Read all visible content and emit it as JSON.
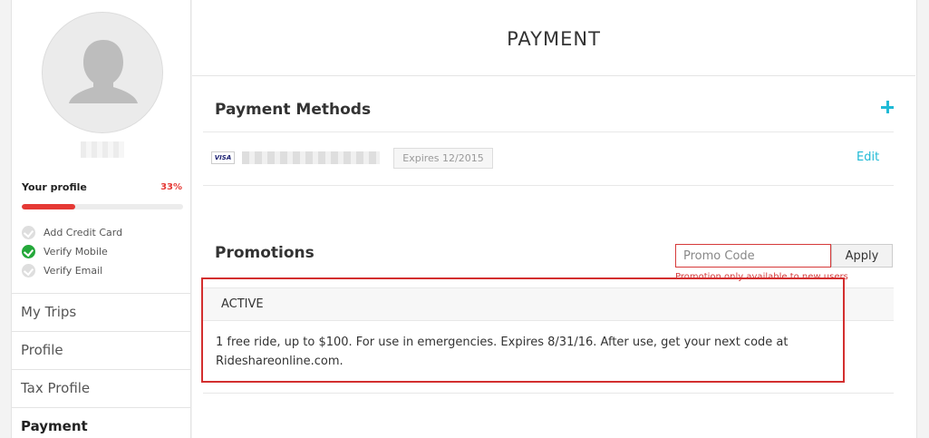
{
  "sidebar": {
    "profile_label": "Your profile",
    "profile_percent_text": "33%",
    "profile_percent": 33,
    "checklist": [
      {
        "label": "Add Credit Card",
        "done": false
      },
      {
        "label": "Verify Mobile",
        "done": true
      },
      {
        "label": "Verify Email",
        "done": false
      }
    ],
    "nav": [
      {
        "label": "My Trips",
        "active": false
      },
      {
        "label": "Profile",
        "active": false
      },
      {
        "label": "Tax Profile",
        "active": false
      },
      {
        "label": "Payment",
        "active": true
      }
    ]
  },
  "main": {
    "title": "PAYMENT",
    "payment_methods": {
      "title": "Payment Methods",
      "card_brand": "VISA",
      "expires": "Expires 12/2015",
      "edit_label": "Edit"
    },
    "promotions": {
      "title": "Promotions",
      "input_placeholder": "Promo Code",
      "input_value": "",
      "apply_label": "Apply",
      "error_text": "Promotion only available to new users",
      "active_header": "ACTIVE",
      "description": "1 free ride, up to $100. For use in emergencies. Expires 8/31/16. After use, get your next code at Rideshareonline.com."
    }
  },
  "colors": {
    "accent": "#1fbad6",
    "error": "#d63a3a",
    "success": "#24a83a",
    "highlight": "#d32f2f"
  }
}
